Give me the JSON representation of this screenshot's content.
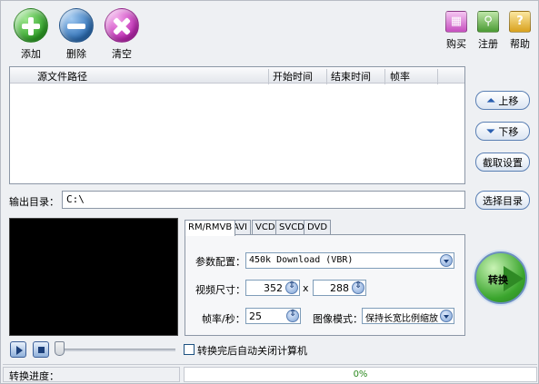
{
  "toolbar": {
    "add_label": "添加",
    "delete_label": "删除",
    "clear_label": "清空",
    "buy_label": "购买",
    "register_label": "注册",
    "help_label": "帮助"
  },
  "file_list": {
    "columns": [
      "源文件路径",
      "开始时间",
      "结束时间",
      "帧率"
    ],
    "rows": []
  },
  "side_buttons": {
    "move_up": "上移",
    "move_down": "下移",
    "capture_settings": "截取设置",
    "choose_dir": "选择目录"
  },
  "output": {
    "label": "输出目录：",
    "value": "C:\\"
  },
  "tabs": [
    "RM/RMVB",
    "AVI",
    "VCD",
    "SVCD",
    "DVD"
  ],
  "settings": {
    "preset_label": "参数配置：",
    "preset_value": "450k Download (VBR)",
    "size_label": "视频尺寸：",
    "width": "352",
    "size_sep": "x",
    "height": "288",
    "fps_label": "帧率/秒：",
    "fps_value": "25",
    "image_mode_label": "图像模式：",
    "image_mode_value": "保持长宽比例缩放"
  },
  "convert_button": "转换",
  "shutdown_option": "转换完后自动关闭计算机",
  "status": {
    "label": "转换进度：",
    "progress_text": "0%",
    "progress": 0
  },
  "colors": {
    "accent": "#2c6fb7",
    "progress": "#2c8a1f"
  }
}
